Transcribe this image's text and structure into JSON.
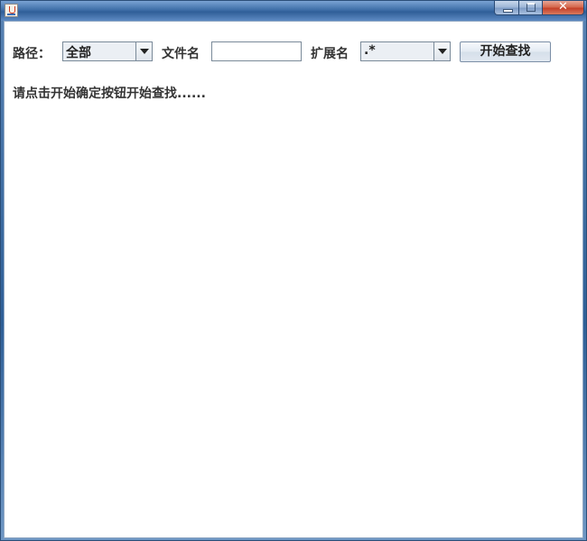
{
  "window": {
    "title": "",
    "controls": {
      "minimize_icon": "minimize-icon",
      "maximize_icon": "maximize-icon",
      "close_glyph": "✕"
    }
  },
  "search_bar": {
    "path_label": "路径：",
    "path_value": "全部",
    "filename_label": "文件名",
    "filename_value": "",
    "extension_label": "扩展名",
    "extension_value": ".*",
    "start_button_label": "开始查找"
  },
  "status_text": "请点击开始确定按钮开始查找......"
}
